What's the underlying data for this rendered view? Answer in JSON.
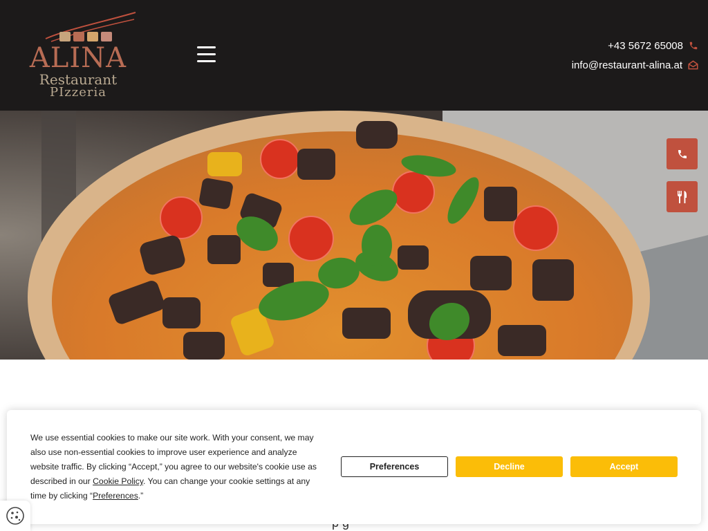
{
  "header": {
    "logo": {
      "brand": "ALINA",
      "line1": "Restaurant",
      "line2": "PIzzeria"
    },
    "phone": "+43 5672 65008",
    "email": "info@restaurant-alina.at"
  },
  "icons": {
    "menu": "hamburger-icon",
    "phone": "phone-icon",
    "email": "envelope-open-icon",
    "float_phone": "phone-icon",
    "float_menu": "fork-knife-icon",
    "cookie": "cookie-icon"
  },
  "colors": {
    "header_bg": "#1c1a1a",
    "accent": "#c0513e",
    "cookie_button": "#fbbd08"
  },
  "cookie": {
    "text_part1": "We use essential cookies to make our site work. With your consent, we may also use non-essential cookies to improve user experience and analyze website traffic. By clicking “Accept,” you agree to our website's cookie use as described in our ",
    "cookie_policy_link": "Cookie Policy",
    "text_part2": ". You can change your cookie settings at any time by clicking “",
    "preferences_link": "Preferences",
    "text_part3": ".”",
    "preferences_button": "Preferences",
    "decline_button": "Decline",
    "accept_button": "Accept"
  },
  "content": {
    "partial_heading": "p      g"
  }
}
